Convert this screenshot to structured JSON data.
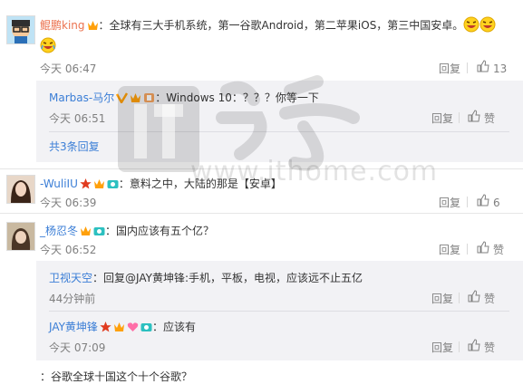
{
  "comments": [
    {
      "author": "鲲鹏king",
      "text": "：全球有三大手机系统，第一谷歌Android，第二苹果iOS，第三中国安卓。",
      "time": "今天 06:47",
      "reply_label": "回复",
      "like_count": "13",
      "replies": [
        {
          "author": "Marbas-马尔",
          "text": "：Windows 10：？？？你等一下",
          "time": "今天 06:51",
          "reply_label": "回复",
          "like_label": "赞"
        }
      ],
      "more_replies": "共3条回复"
    },
    {
      "author": "-WuliIU",
      "text": "：意料之中，大陆的那是【安卓】",
      "time": "今天 06:39",
      "reply_label": "回复",
      "like_count": "6"
    },
    {
      "author": "_杨忍冬",
      "text": "：国内应该有五个亿？",
      "time": "今天 06:52",
      "reply_label": "回复",
      "like_label": "赞",
      "replies": [
        {
          "author": "卫视天空",
          "text": "：回复@JAY黄坤锋:手机，平板，电视，应该远不止五亿",
          "time": "44分钟前",
          "reply_label": "回复",
          "like_label": "赞"
        },
        {
          "author": "JAY黄坤锋",
          "text": "：应该有",
          "time": "今天 07:09",
          "reply_label": "回复",
          "like_label": "赞"
        }
      ]
    }
  ],
  "partial_bottom": "：谷歌全球十国这个十个谷歌？",
  "watermark": "www.ithome.com",
  "colors": {
    "name": "#eb7350",
    "link": "#3b7ed6",
    "vip": "#ffa00a",
    "gray": "#808080"
  }
}
